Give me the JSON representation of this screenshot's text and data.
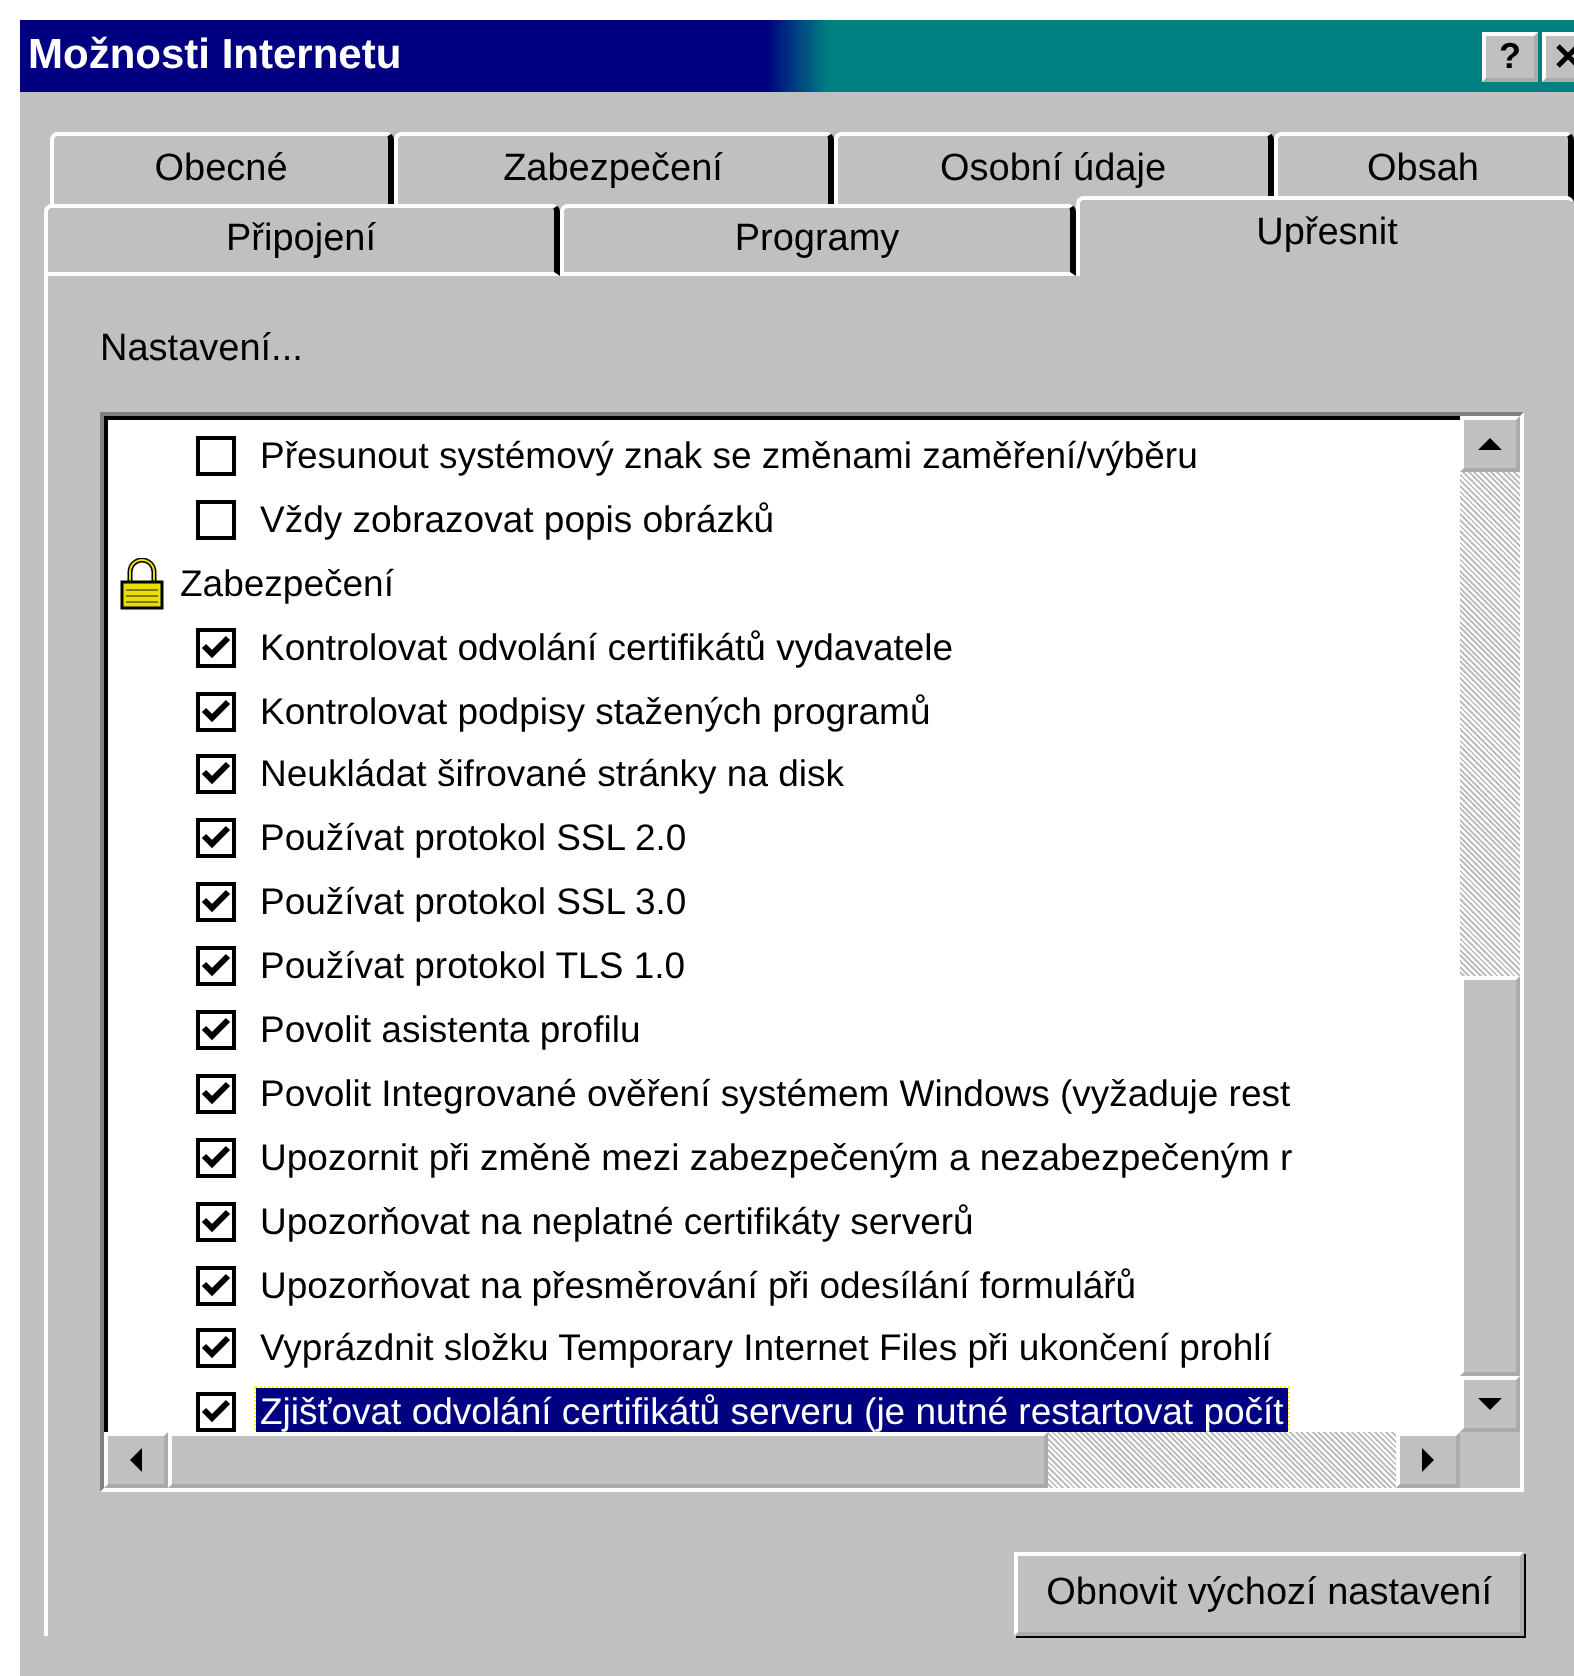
{
  "window": {
    "title": "Možnosti Internetu",
    "help": "?"
  },
  "tab_rows": [
    [
      {
        "label": "Obecné",
        "selected": false
      },
      {
        "label": "Zabezpečení",
        "selected": false
      },
      {
        "label": "Osobní údaje",
        "selected": false
      },
      {
        "label": "Obsah",
        "selected": false
      }
    ],
    [
      {
        "label": "Připojení",
        "selected": false
      },
      {
        "label": "Programy",
        "selected": false
      },
      {
        "label": "Upřesnit",
        "selected": true
      }
    ]
  ],
  "settings_label": "Nastavení...",
  "settings": [
    {
      "kind": "checkbox",
      "label": "Přesunout systémový znak se změnami zaměření/výběru",
      "checked": false,
      "selected": false
    },
    {
      "kind": "checkbox",
      "label": "Vždy zobrazovat popis obrázků",
      "checked": false,
      "selected": false
    },
    {
      "kind": "group",
      "label": "Zabezpečení",
      "selected": false,
      "children": [
        {
          "kind": "checkbox",
          "label": "Kontrolovat odvolání certifikátů vydavatele",
          "checked": true,
          "selected": false
        },
        {
          "kind": "checkbox",
          "label": "Kontrolovat podpisy stažených programů",
          "checked": true,
          "selected": false
        },
        {
          "kind": "checkbox",
          "label": "Neukládat šifrované stránky na disk",
          "checked": true,
          "selected": false
        },
        {
          "kind": "checkbox",
          "label": "Používat protokol SSL 2.0",
          "checked": true,
          "selected": false
        },
        {
          "kind": "checkbox",
          "label": "Používat protokol SSL 3.0",
          "checked": true,
          "selected": false
        },
        {
          "kind": "checkbox",
          "label": "Používat protokol TLS 1.0",
          "checked": true,
          "selected": false
        },
        {
          "kind": "checkbox",
          "label": "Povolit asistenta profilu",
          "checked": true,
          "selected": false
        },
        {
          "kind": "checkbox",
          "label": "Povolit Integrované ověření systémem Windows (vyžaduje rest",
          "checked": true,
          "selected": false
        },
        {
          "kind": "checkbox",
          "label": "Upozornit při změně mezi zabezpečeným a nezabezpečeným r",
          "checked": true,
          "selected": false
        },
        {
          "kind": "checkbox",
          "label": "Upozorňovat na neplatné certifikáty serverů",
          "checked": true,
          "selected": false
        },
        {
          "kind": "checkbox",
          "label": "Upozorňovat na přesměrování při odesílání formulářů",
          "checked": true,
          "selected": false
        },
        {
          "kind": "checkbox",
          "label": "Vyprázdnit složku Temporary Internet Files při ukončení prohlí",
          "checked": true,
          "selected": false
        },
        {
          "kind": "checkbox",
          "label": "Zjišťovat odvolání certifikátů serveru (je nutné restartovat počít",
          "checked": true,
          "selected": true
        }
      ]
    }
  ],
  "reset_button": "Obnovit výchozí nastavení"
}
